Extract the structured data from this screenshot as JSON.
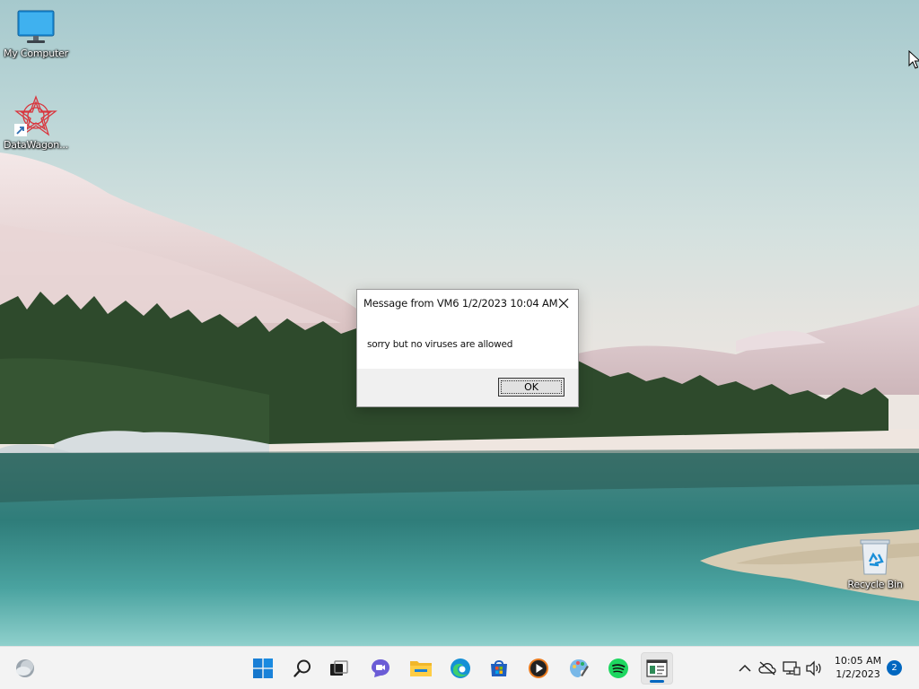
{
  "desktop": {
    "icons": [
      {
        "label": "My Computer",
        "icon": "monitor-icon"
      },
      {
        "label": "DataWagon...",
        "icon": "datawagon-icon"
      },
      {
        "label": "Recycle Bin",
        "icon": "recycle-bin-icon"
      }
    ]
  },
  "dialog": {
    "title": "Message from VM6 1/2/2023 10:04 AM",
    "message": "sorry but no viruses are allowed",
    "ok_label": "OK",
    "close_icon": "close-icon"
  },
  "taskbar": {
    "widgets_icon": "weather-widget-icon",
    "pinned": [
      {
        "name": "start",
        "icon": "windows-logo-icon"
      },
      {
        "name": "search",
        "icon": "search-icon"
      },
      {
        "name": "task-view",
        "icon": "task-view-icon"
      },
      {
        "name": "chat",
        "icon": "chat-icon"
      },
      {
        "name": "file-explorer",
        "icon": "folder-icon"
      },
      {
        "name": "edge",
        "icon": "edge-icon"
      },
      {
        "name": "store",
        "icon": "store-icon"
      },
      {
        "name": "media-player",
        "icon": "play-icon"
      },
      {
        "name": "paint",
        "icon": "paint-icon"
      },
      {
        "name": "spotify",
        "icon": "spotify-icon"
      },
      {
        "name": "running-app",
        "icon": "app-window-icon"
      }
    ],
    "tray": {
      "icons": [
        "chevron-up-icon",
        "cloud-offline-icon",
        "network-icon",
        "volume-icon"
      ],
      "time": "10:05 AM",
      "date": "1/2/2023",
      "notifications": "2"
    },
    "colors": {
      "accent": "#0067c0",
      "background": "#f3f3f3"
    }
  }
}
